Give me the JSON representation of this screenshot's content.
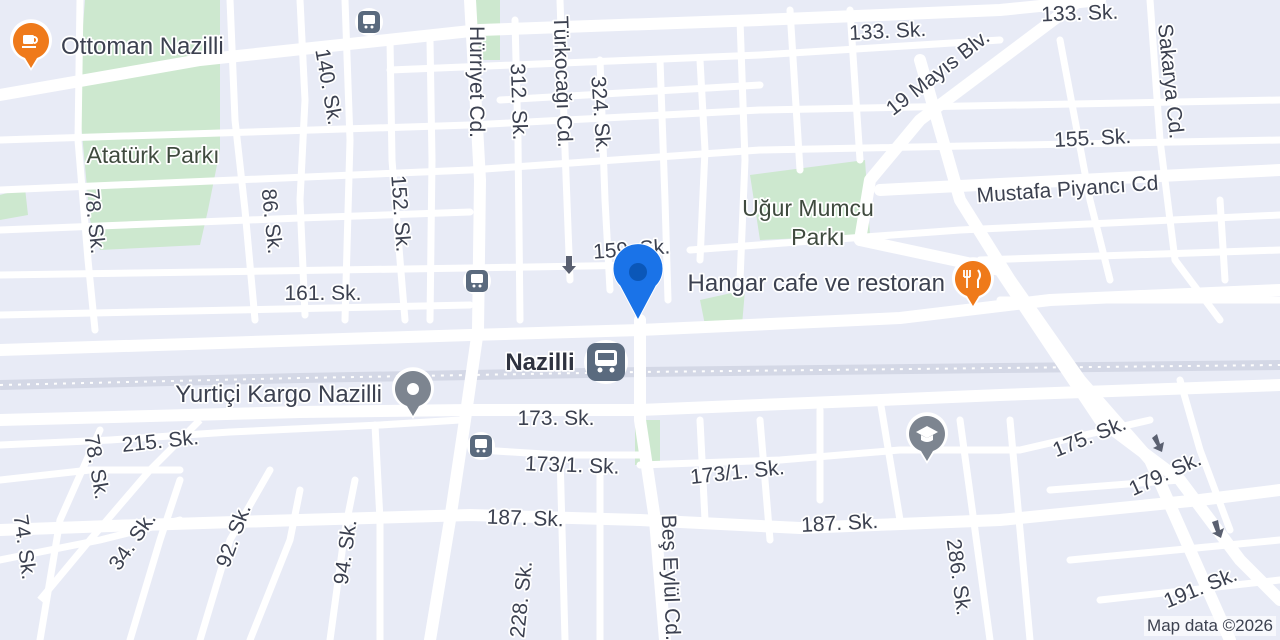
{
  "colors": {
    "background": "#e8ebf6",
    "road": "#ffffff",
    "park": "#cde8cf",
    "poi_orange": "#ef7a1a",
    "poi_gray": "#7d8590",
    "transit": "#5a6a7e",
    "location_blue": "#1a73e8"
  },
  "pois": {
    "ottoman": {
      "label": "Ottoman Nazilli",
      "icon": "cafe-icon"
    },
    "hangar": {
      "label": "Hangar cafe ve restoran",
      "icon": "restaurant-icon"
    },
    "yurtici": {
      "label": "Yurtiçi Kargo Nazilli",
      "icon": "pin-icon"
    },
    "school": {
      "icon": "school-icon"
    },
    "station": {
      "label": "Nazilli",
      "icon": "bus-station-icon"
    }
  },
  "parks": {
    "ataturk": "Atatürk Parkı",
    "ugur_line1": "Uğur Mumcu",
    "ugur_line2": "Parkı"
  },
  "streets": {
    "s133a": "133. Sk.",
    "s133b": "133. Sk.",
    "s140": "140. Sk.",
    "hurriyet": "Hürriyet Cd.",
    "s312": "312. Sk.",
    "turkocagi": "Türkocağı Cd.",
    "s324": "324. Sk.",
    "mayis": "19 Mayıs Blv.",
    "sakarya": "Sakarya Cd.",
    "s155": "155. Sk.",
    "piyanci": "Mustafa Piyancı Cd",
    "s78a": "78. Sk.",
    "s86": "86. Sk.",
    "s152": "152. Sk.",
    "s159": "159. Sk.",
    "s161": "161. Sk.",
    "s173": "173. Sk.",
    "s215": "215. Sk.",
    "s78b": "78. Sk.",
    "s1731a": "173/1. Sk.",
    "s1731b": "173/1. Sk.",
    "s175": "175. Sk.",
    "s179": "179. Sk.",
    "s187a": "187. Sk.",
    "s187b": "187. Sk.",
    "s74": "74. Sk.",
    "s34": "34. Sk.",
    "s92": "92. Sk.",
    "s94": "94. Sk.",
    "s228": "228. Sk.",
    "besEylul": "Beş Eylül Cd.",
    "s286": "286. Sk.",
    "s191": "191. Sk."
  },
  "attribution": "Map data ©2026"
}
